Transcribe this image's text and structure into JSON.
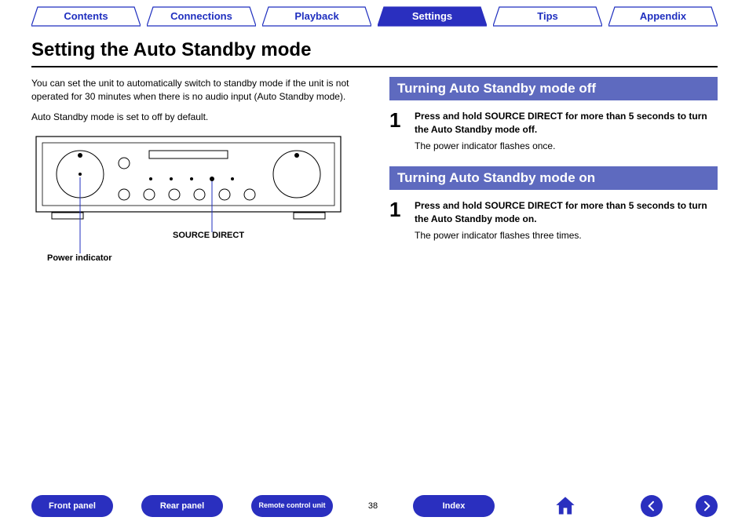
{
  "tabs": {
    "items": [
      {
        "label": "Contents",
        "active": false
      },
      {
        "label": "Connections",
        "active": false
      },
      {
        "label": "Playback",
        "active": false
      },
      {
        "label": "Settings",
        "active": true
      },
      {
        "label": "Tips",
        "active": false
      },
      {
        "label": "Appendix",
        "active": false
      }
    ]
  },
  "title": "Setting the Auto Standby mode",
  "intro": {
    "p1": "You can set the unit to automatically switch to standby mode if the unit is not operated for 30 minutes when there is no audio input (Auto Standby mode).",
    "p2": "Auto Standby mode is set to off by default."
  },
  "diagram": {
    "callout_source": "SOURCE DIRECT",
    "callout_power": "Power indicator"
  },
  "sections": {
    "off": {
      "heading": "Turning Auto Standby mode off",
      "step_num": "1",
      "bold": "Press and hold SOURCE DIRECT for more than 5 seconds to turn the Auto Standby mode off.",
      "plain": "The power indicator flashes once."
    },
    "on": {
      "heading": "Turning Auto Standby mode on",
      "step_num": "1",
      "bold": "Press and hold SOURCE DIRECT for more than 5 seconds to turn the Auto Standby mode on.",
      "plain": "The power indicator flashes three times."
    }
  },
  "bottom": {
    "front": "Front panel",
    "rear": "Rear panel",
    "remote": "Remote control unit",
    "index": "Index",
    "page": "38"
  }
}
